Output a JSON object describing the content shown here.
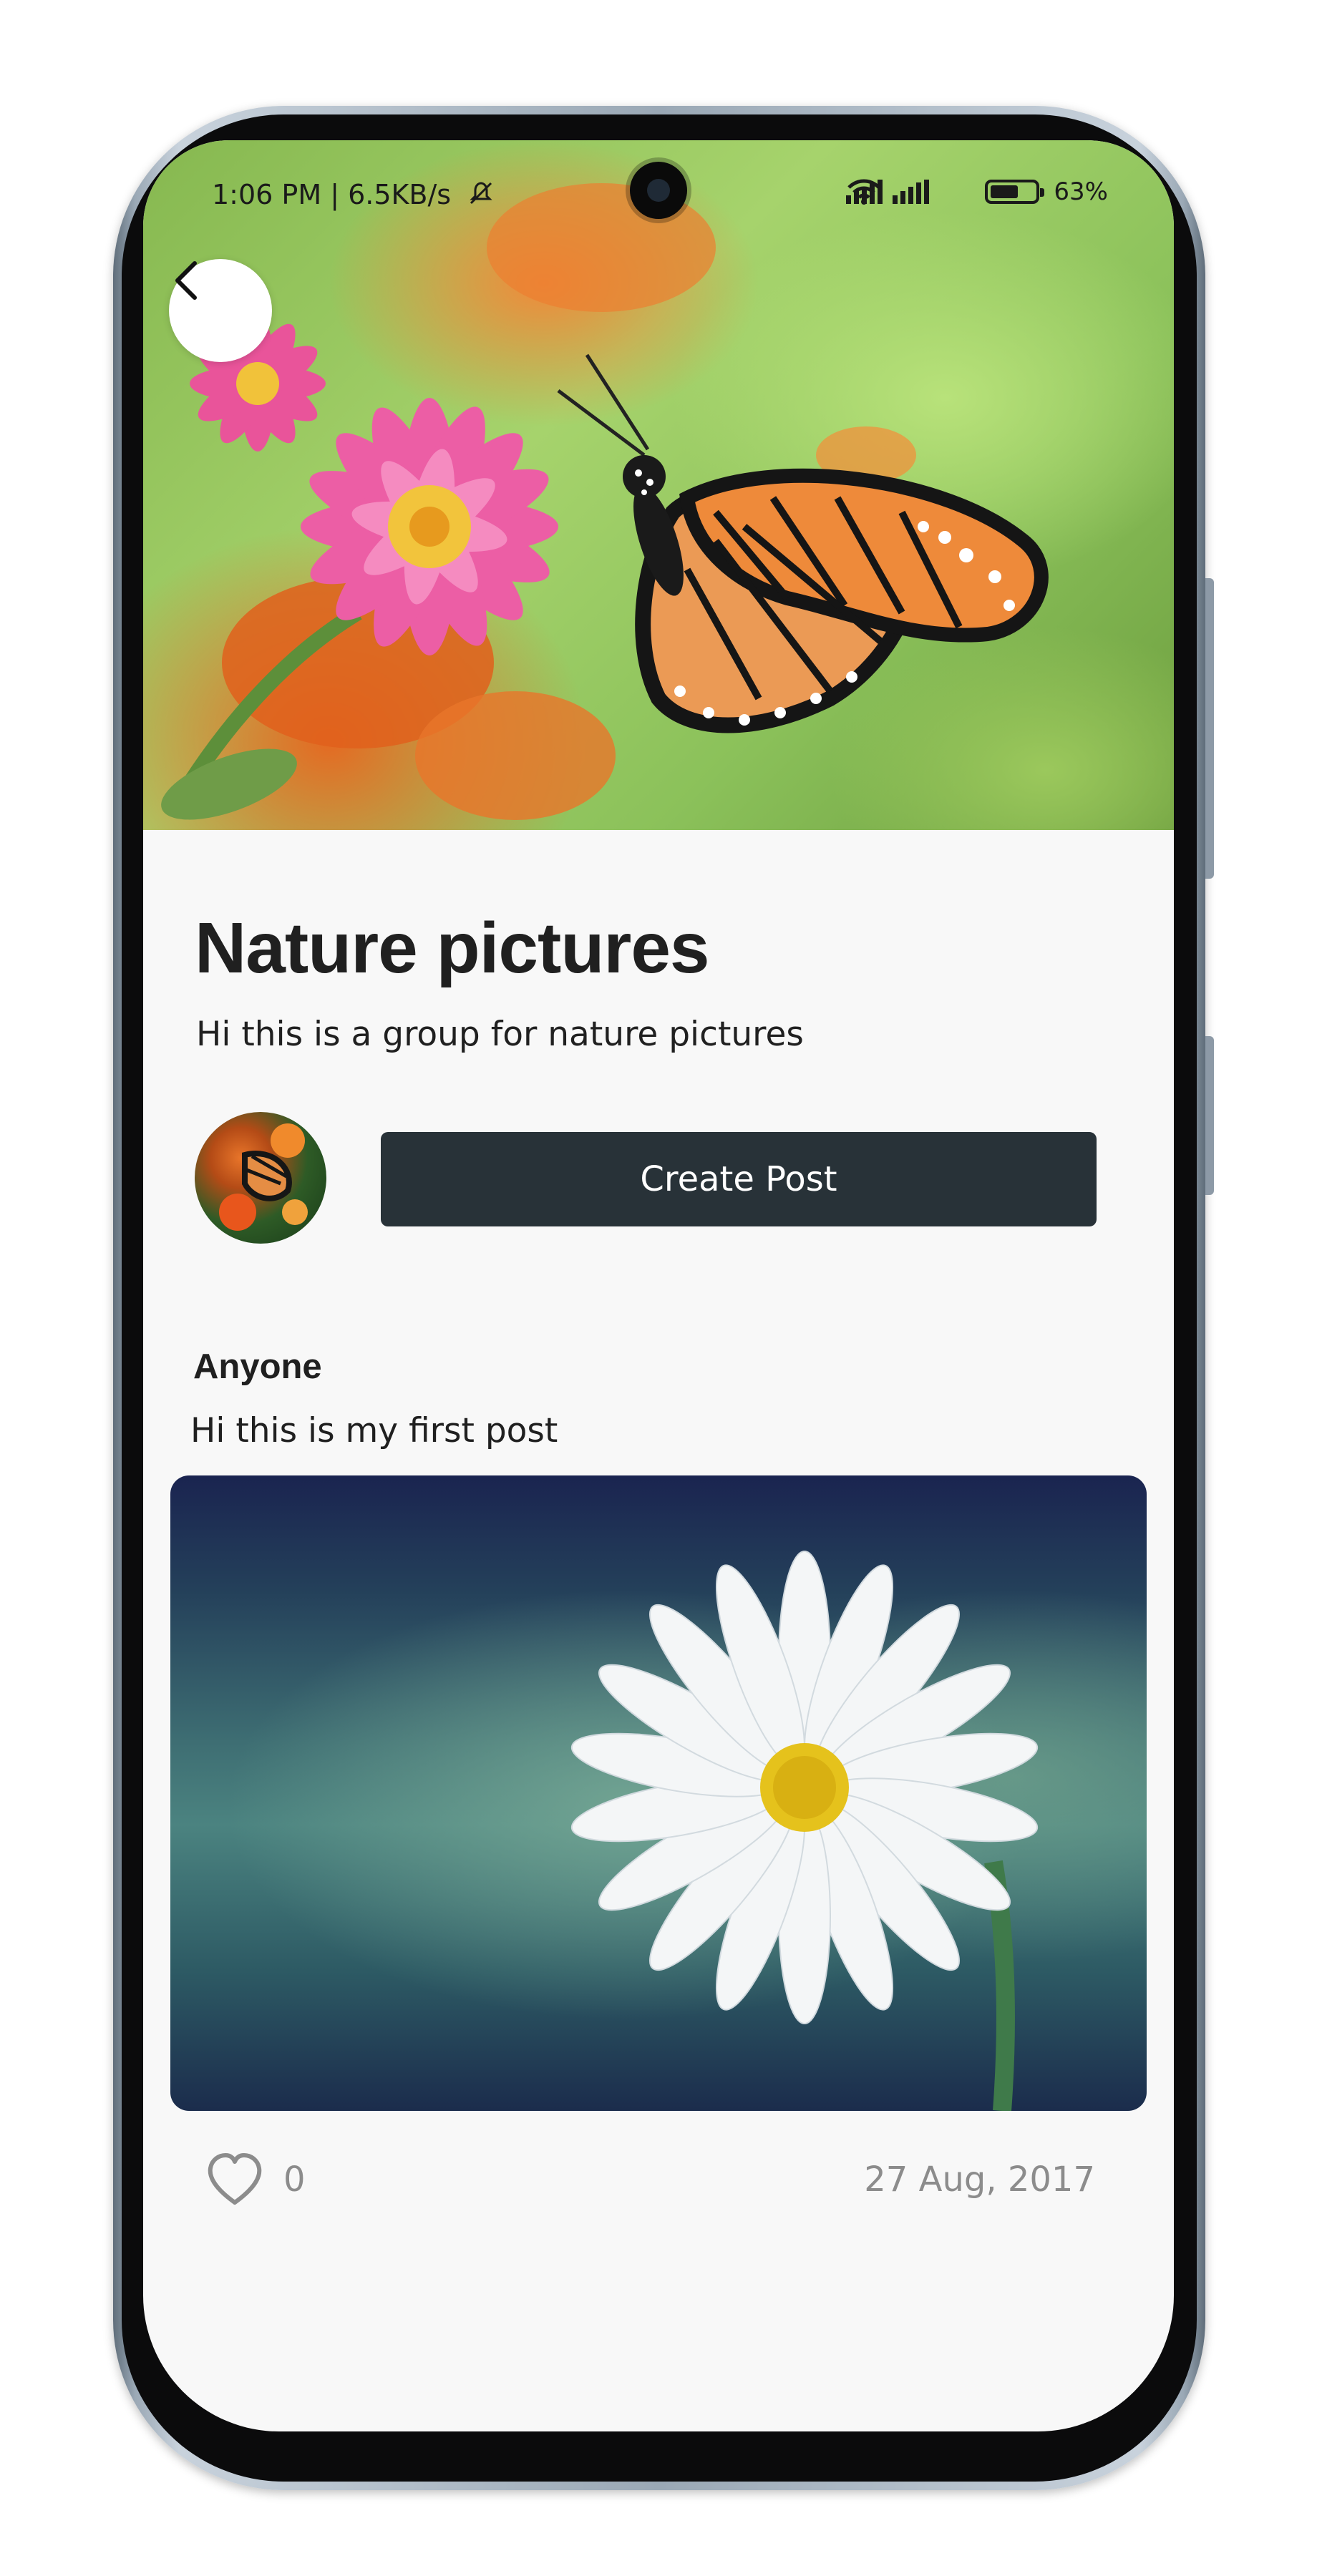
{
  "status_bar": {
    "time_speed": "1:06 PM | 6.5KB/s",
    "battery_percent": "63%",
    "battery_level": 0.63,
    "icons": [
      "mute-icon",
      "signal-icon",
      "signal-icon",
      "wifi-icon",
      "battery-icon"
    ]
  },
  "header": {
    "back_icon": "chevron-left-icon"
  },
  "group": {
    "title": "Nature pictures",
    "description": "Hi this is a group for nature pictures",
    "create_post_label": "Create Post"
  },
  "post": {
    "author": "Anyone",
    "text": "Hi this is my first post",
    "like_count": "0",
    "date": "27 Aug, 2017",
    "like_icon": "heart-outline-icon"
  },
  "colors": {
    "button_bg": "#283238",
    "title_text": "#202020",
    "muted_text": "#8c8c8c",
    "screen_bg": "#f8f8f8"
  }
}
